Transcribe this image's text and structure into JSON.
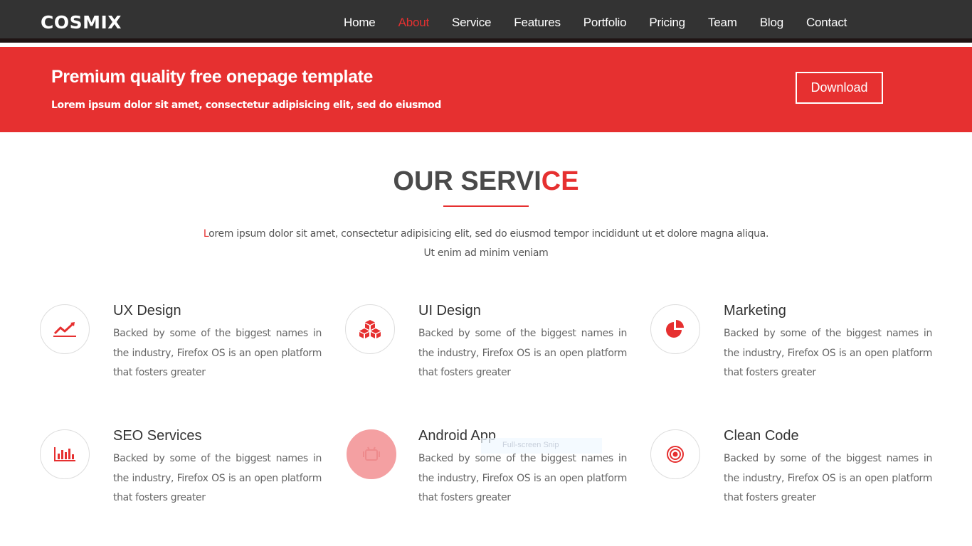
{
  "brand": {
    "logo": "COSMIX"
  },
  "nav": [
    {
      "label": "Home",
      "active": false
    },
    {
      "label": "About",
      "active": true
    },
    {
      "label": "Service",
      "active": false
    },
    {
      "label": "Features",
      "active": false
    },
    {
      "label": "Portfolio",
      "active": false
    },
    {
      "label": "Pricing",
      "active": false
    },
    {
      "label": "Team",
      "active": false
    },
    {
      "label": "Blog",
      "active": false
    },
    {
      "label": "Contact",
      "active": false
    }
  ],
  "banner": {
    "title": "Premium quality free onepage template",
    "subtitle": "Lorem ipsum dolor sit amet, consectetur adipisicing elit, sed do eiusmod",
    "download_label": "Download"
  },
  "section": {
    "title_main": "OUR SERVI",
    "title_accent": "CE",
    "desc_first_letter": "L",
    "desc_line1_rest": "orem ipsum dolor sit amet, consectetur adipisicing elit, sed do eiusmod tempor incididunt ut et dolore magna aliqua.",
    "desc_line2": "Ut enim ad minim veniam"
  },
  "services": [
    {
      "title": "UX Design",
      "desc": "Backed by some of the biggest names in the industry, Firefox OS is an open platform that fosters greater",
      "icon": "line-chart-icon"
    },
    {
      "title": "UI Design",
      "desc": "Backed by some of the biggest names in the industry, Firefox OS is an open platform that fosters greater",
      "icon": "cubes-icon"
    },
    {
      "title": "Marketing",
      "desc": "Backed by some of the biggest names in the industry, Firefox OS is an open platform that fosters greater",
      "icon": "pie-chart-icon"
    },
    {
      "title": "SEO Services",
      "desc": "Backed by some of the biggest names in the industry, Firefox OS is an open platform that fosters greater",
      "icon": "bar-chart-icon"
    },
    {
      "title": "Android App",
      "desc": "Backed by some of the biggest names in the industry, Firefox OS is an open platform that fosters greater",
      "icon": "android-icon"
    },
    {
      "title": "Clean Code",
      "desc": "Backed by some of the biggest names in the industry, Firefox OS is an open platform that fosters greater",
      "icon": "target-icon"
    }
  ],
  "overlay": {
    "tooltip": "Full-screen Snip"
  },
  "colors": {
    "accent": "#e63030",
    "navbar": "#333333",
    "icon_hover": "#f4a0a2"
  }
}
